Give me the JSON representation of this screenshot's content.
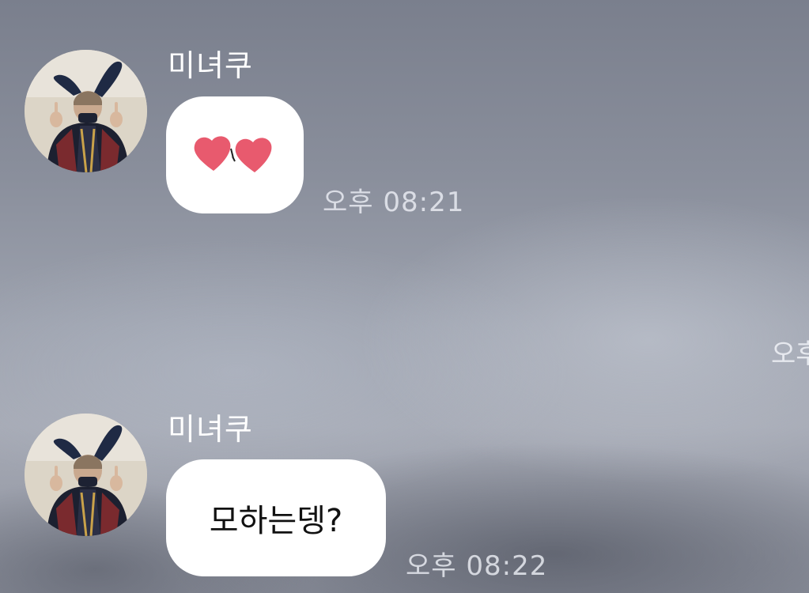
{
  "chat": {
    "messages": [
      {
        "sender": "미녀쿠",
        "content_type": "emoji",
        "emoji": "two-hearts-icon",
        "time": "오후 08:21"
      },
      {
        "sender": "미녀쿠",
        "content_type": "text",
        "text": "모하는뎅?",
        "time": "오후 08:22"
      }
    ],
    "edge_fragment": "오후"
  },
  "colors": {
    "bubble": "#ffffff",
    "heart": "#e85a6e",
    "sender_text": "#ffffff",
    "timestamp_text": "#ebeef4"
  }
}
